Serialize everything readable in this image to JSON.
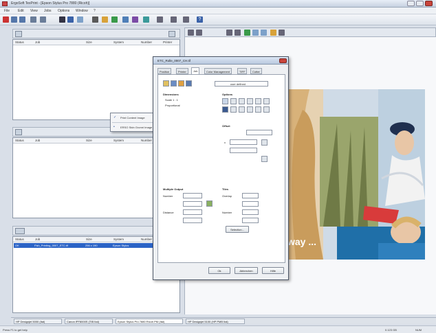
{
  "window": {
    "title": "ErgoSoft TexPrint - [Epson Stylus Pro 7880 (Ricoh)]"
  },
  "menu": [
    "File",
    "Edit",
    "View",
    "Jobs",
    "Options",
    "Window",
    "?"
  ],
  "queue_columns": [
    "Status",
    "Job",
    "Size",
    "System",
    "Number",
    "Printer"
  ],
  "done_columns": [
    "Status",
    "Job",
    "Size",
    "System",
    "Number"
  ],
  "selected_job": {
    "status": "OK",
    "job": "Fish_Printing_0007_ETC.tif",
    "size": "256 x 190",
    "system": "Epson Stylus"
  },
  "dialog": {
    "title": "ETC_Rolle_0007_CH.tif",
    "tabs": [
      "Position",
      "Printer",
      "Job",
      "Color Management",
      "TIFF",
      "Cutter"
    ],
    "toolbar_label": "user defined",
    "dimensions_label": "Dimensions",
    "scale_label": "Scale 1 : 1",
    "proportional_label": "Proportional",
    "options_label": "Options",
    "offset_label": "Offset",
    "x_label": "x",
    "multiple_output_label": "Multiple Output",
    "number_label": "Number",
    "distance_label": "Distance",
    "tiles_label": "Tiles",
    "overlap_label": "Overlap",
    "tiles_number_label": "Number",
    "selection_button": "Selection...",
    "ok_button": "Ok",
    "cancel_button": "Abbrechen",
    "help_button": "Hilfe"
  },
  "context_menu": {
    "item1": "Print Content Image",
    "item2": "ERSO Stdn Gromri Image (10 Byr/bm Byr/Fm/I/V)"
  },
  "ad_text": "way ...",
  "bottom_tabs": [
    "HP Designjet 5000 (Ital)",
    "Canon iPF8000S (TIB Ital)",
    "Epson Stylus Pro 7880 Ricoh PM (Ital)",
    "HP Designjet 5100 (HP PMB Ital)"
  ],
  "status": {
    "left": "Press F1 to get help",
    "mid": "0.123 GB",
    "right": "NUM"
  }
}
